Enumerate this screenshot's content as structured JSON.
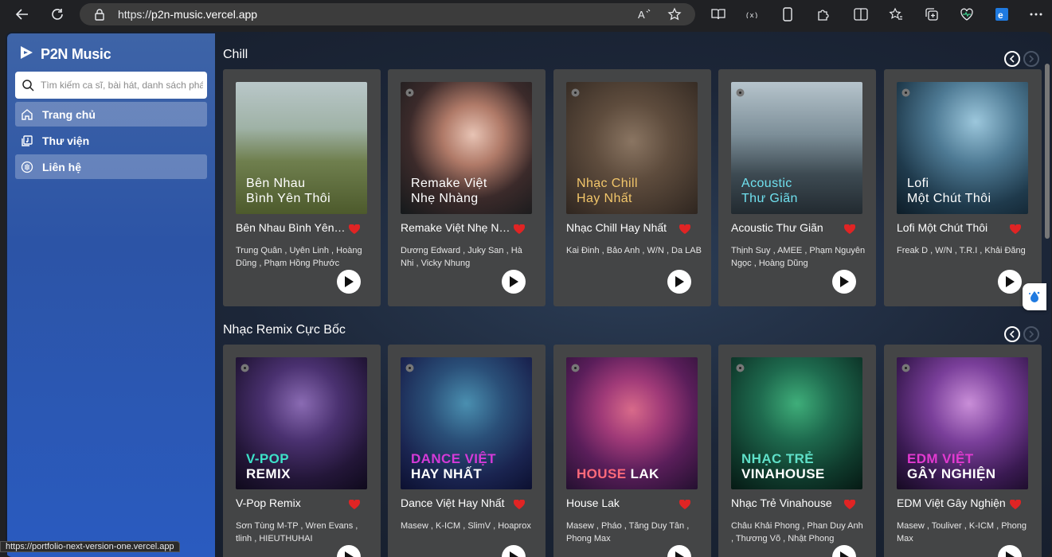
{
  "browser": {
    "url_prefix": "https://",
    "url_host": "p2n-music.vercel.app",
    "status_url": "https://portfolio-next-version-one.vercel.app"
  },
  "app": {
    "name": "P2N Music",
    "search_placeholder": "Tìm kiếm ca sĩ, bài hát, danh sách phát",
    "menu": [
      {
        "label": "Trang chủ",
        "icon": "home-icon",
        "active": true
      },
      {
        "label": "Thư viện",
        "icon": "library-icon",
        "active": false
      },
      {
        "label": "Liên hệ",
        "icon": "contact-icon",
        "active": true
      }
    ]
  },
  "sections": [
    {
      "title": "Chill",
      "cards": [
        {
          "cover_line1": "Bên Nhau",
          "cover_line2": "Bình Yên Thôi",
          "title": "Bên Nhau Bình Yên Thôi",
          "artists": "Trung Quân , Uyên Linh , Hoàng Dũng , Phạm Hồng Phước"
        },
        {
          "cover_line1": "Remake Việt",
          "cover_line2": "Nhẹ Nhàng",
          "title": "Remake Việt Nhẹ Nhàng",
          "artists": "Dương Edward , Juky San , Hà Nhi , Vicky Nhung"
        },
        {
          "cover_line1": "Nhạc Chill",
          "cover_line2": "Hay Nhất",
          "title": "Nhạc Chill Hay Nhất",
          "artists": "Kai Đinh , Bảo Anh , W/N , Da LAB"
        },
        {
          "cover_line1": "Acoustic",
          "cover_line2": "Thư Giãn",
          "title": "Acoustic Thư Giãn",
          "artists": "Thịnh Suy , AMEE , Phạm Nguyên Ngọc , Hoàng Dũng"
        },
        {
          "cover_line1": "Lofi",
          "cover_line2": "Một Chút Thôi",
          "title": "Lofi Một Chút Thôi",
          "artists": "Freak D , W/N , T.R.I , Khải Đăng"
        }
      ]
    },
    {
      "title": "Nhạc Remix Cực Bốc",
      "cards": [
        {
          "cover_line1": "V-POP",
          "cover_line2": "REMIX",
          "title": "V-Pop Remix",
          "artists": "Sơn Tùng M-TP , Wren Evans , tlinh , HIEUTHUHAI"
        },
        {
          "cover_line1": "DANCE VIỆT",
          "cover_line2": "HAY NHẤT",
          "title": "Dance Việt Hay Nhất",
          "artists": "Masew , K-ICM , SlimV , Hoaprox"
        },
        {
          "cover_line1": "HOUSE",
          "cover_line2": "LAK",
          "title": "House Lak",
          "artists": "Masew , Pháo , Tăng Duy Tân , Phong Max"
        },
        {
          "cover_line1": "NHẠC TRẺ",
          "cover_line2": "VINAHOUSE",
          "title": "Nhạc Trẻ Vinahouse",
          "artists": "Châu Khải Phong , Phan Duy Anh , Thương Võ , Nhật Phong"
        },
        {
          "cover_line1": "EDM VIỆT",
          "cover_line2": "GÂY NGHIỆN",
          "title": "EDM Việt Gây Nghiện",
          "artists": "Masew , Touliver , K-ICM , Phong Max"
        }
      ]
    }
  ],
  "colors": {
    "heart": "#e02424",
    "sidebar_top": "#3e64a7",
    "card_bg": "#444546"
  }
}
